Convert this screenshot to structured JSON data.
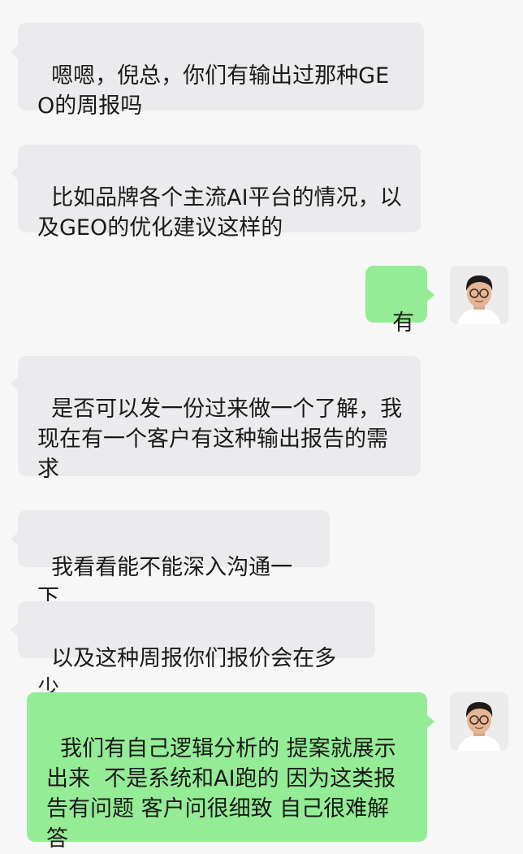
{
  "chat": {
    "messages": [
      {
        "sender": "contact",
        "text": "嗯嗯，倪总，你们有输出过那种GEO的周报吗"
      },
      {
        "sender": "contact",
        "text": "比如品牌各个主流AI平台的情况，以及GEO的优化建议这样的"
      },
      {
        "sender": "me",
        "text": "有"
      },
      {
        "sender": "contact",
        "text": "是否可以发一份过来做一个了解，我现在有一个客户有这种输出报告的需求"
      },
      {
        "sender": "contact",
        "text": "我看看能不能深入沟通一下"
      },
      {
        "sender": "contact",
        "text": "以及这种周报你们报价会在多少"
      },
      {
        "sender": "me",
        "text": "我们有自己逻辑分析的 提案就展示出来  不是系统和AI跑的 因为这类报告有问题 客户问很细致 自己很难解答"
      }
    ]
  },
  "colors": {
    "background": "#f7f7f7",
    "incoming_bubble": "#ebebed",
    "outgoing_bubble": "#95ec96"
  },
  "icons": {
    "avatar": "user-avatar-icon"
  }
}
